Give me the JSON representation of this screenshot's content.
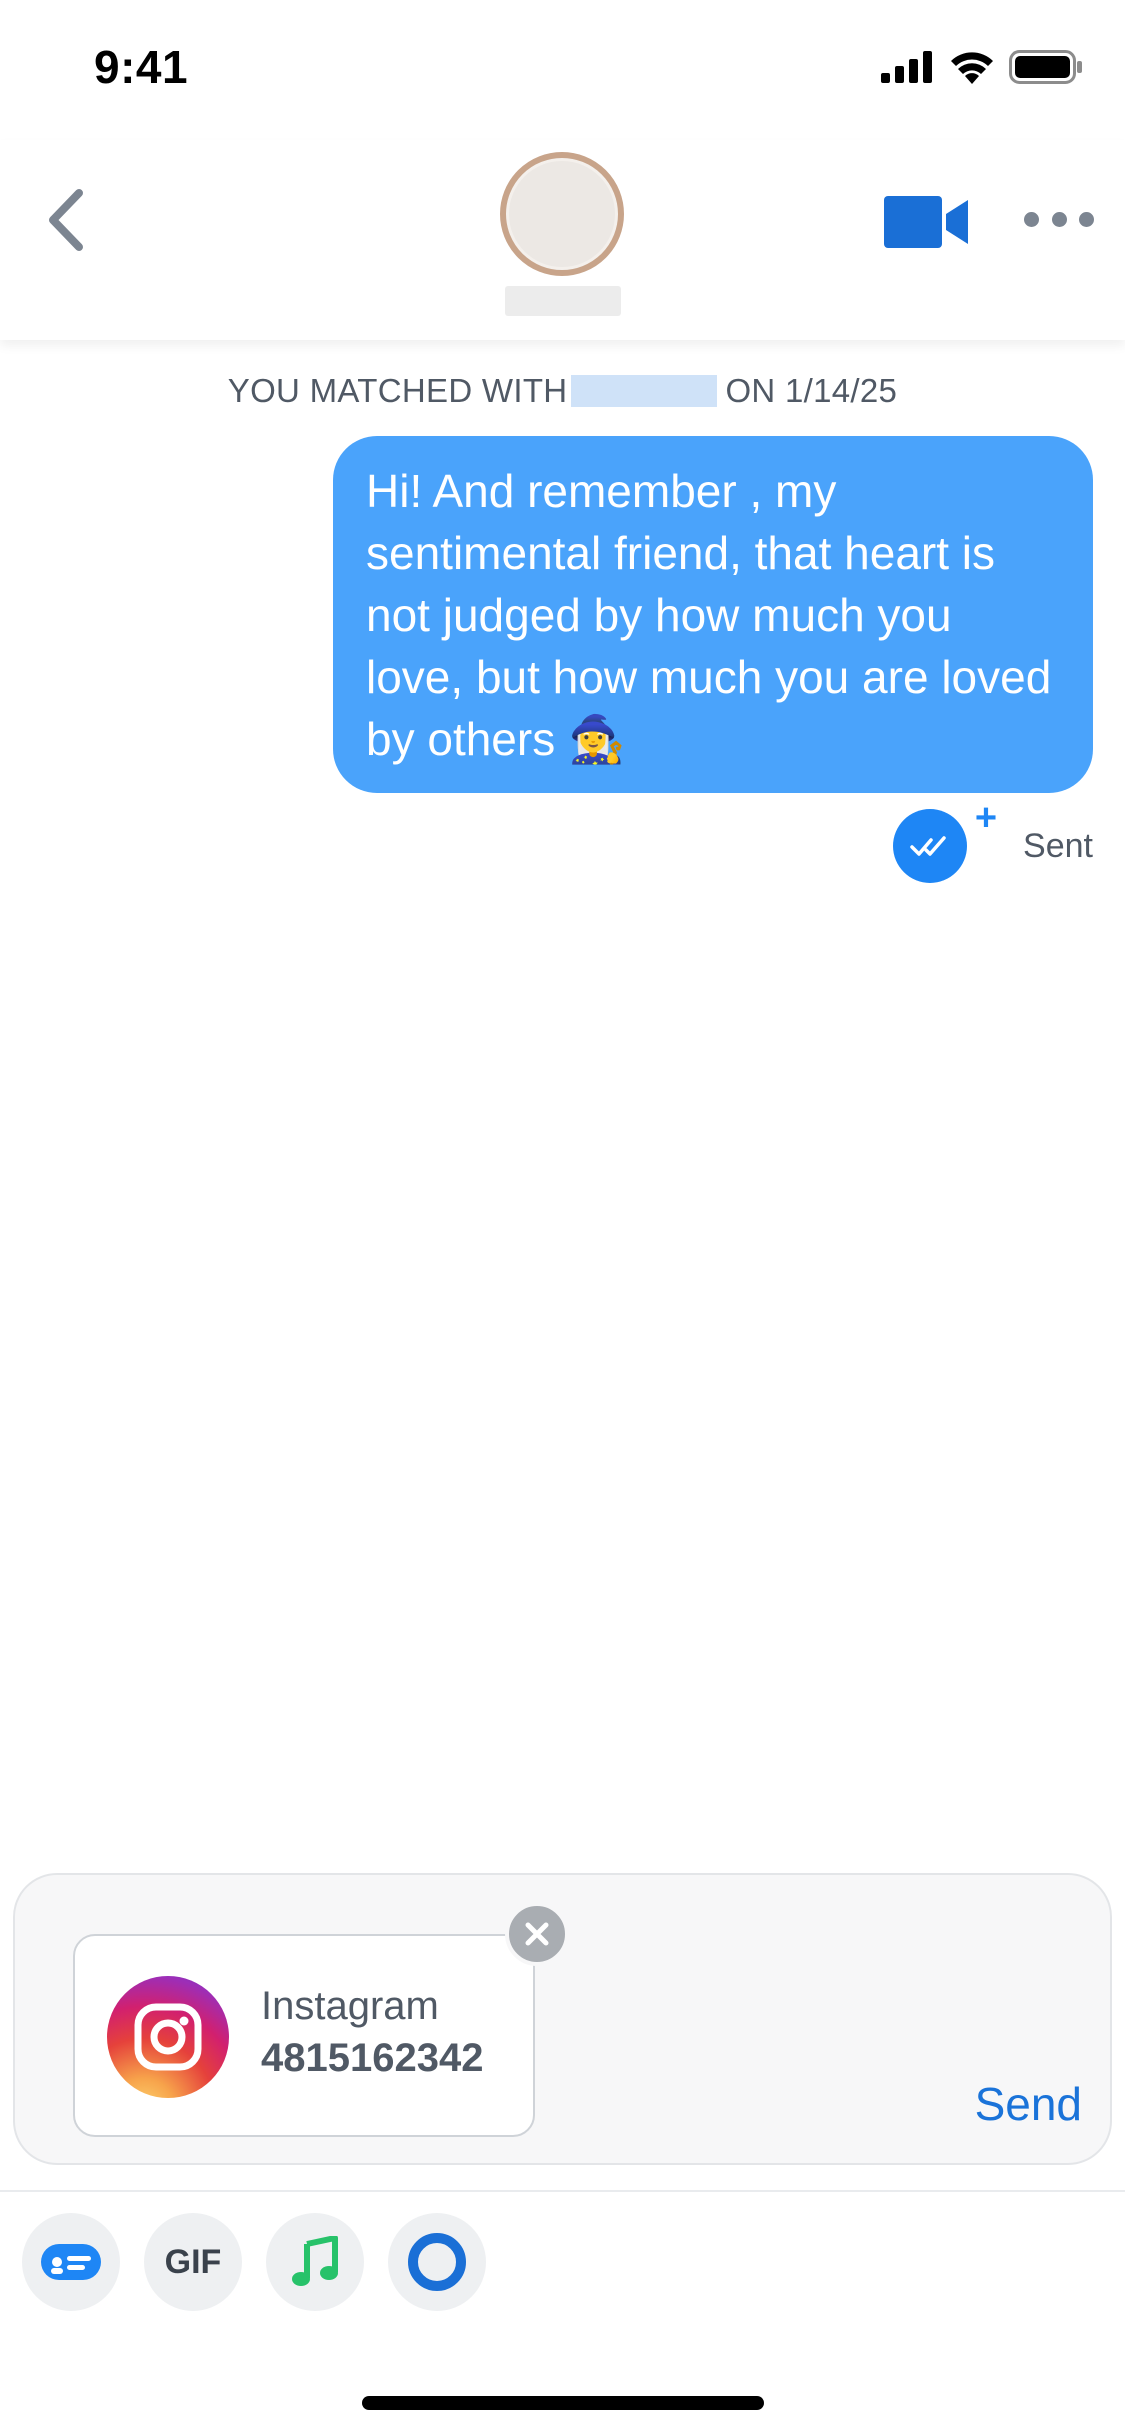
{
  "status_bar": {
    "time": "9:41"
  },
  "header": {
    "back_icon": "chevron-left-icon",
    "video_icon": "video-camera-icon",
    "more_icon": "ellipsis-icon"
  },
  "conversation": {
    "match_prefix": "YOU MATCHED WITH",
    "match_suffix": "ON 1/14/25",
    "message_text": "Hi! And remember , my sentimental friend, that heart is not judged by how much you love, but how much you are loved by others 🧙‍♀️",
    "status_label": "Sent"
  },
  "composer": {
    "attachment": {
      "title": "Instagram",
      "handle": "4815162342",
      "icon": "instagram-icon"
    },
    "send_label": "Send"
  },
  "toolbar": {
    "gif_label": "GIF",
    "items": [
      "sticker-card-icon",
      "gif-icon",
      "music-note-icon",
      "loading-ring-icon"
    ]
  },
  "colors": {
    "bubble": "#4aa3fb",
    "accent": "#1e86f5",
    "send": "#1a73d9",
    "music": "#27c26a"
  }
}
